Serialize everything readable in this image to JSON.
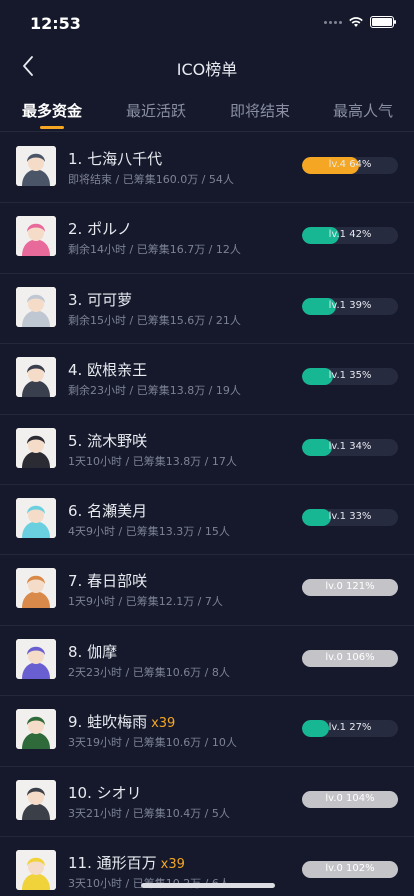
{
  "status": {
    "time": "12:53"
  },
  "nav": {
    "title": "ICO榜单"
  },
  "tabs": [
    {
      "label": "最多资金",
      "active": true
    },
    {
      "label": "最近活跃",
      "active": false
    },
    {
      "label": "即将结束",
      "active": false
    },
    {
      "label": "最高人气",
      "active": false
    }
  ],
  "colors": {
    "teal": "#17b794",
    "orange": "#f5a623",
    "full": "#c4c4c8"
  },
  "items": [
    {
      "title": "1. 七海八千代",
      "badge": "",
      "sub": "即将结束 / 已筹集160.0万 / 54人",
      "level_label": "lv.4 64%",
      "progress": 0.64,
      "color": "#f5a623",
      "full": false,
      "avatar": "#4a5568"
    },
    {
      "title": "2. ポルノ",
      "badge": "",
      "sub": "剩余14小时 / 已筹集16.7万 / 12人",
      "level_label": "lv.1 42%",
      "progress": 0.42,
      "color": "#17b794",
      "full": false,
      "avatar": "#e86a9a"
    },
    {
      "title": "3. 可可萝",
      "badge": "",
      "sub": "剩余15小时 / 已筹集15.6万 / 21人",
      "level_label": "lv.1 39%",
      "progress": 0.39,
      "color": "#17b794",
      "full": false,
      "avatar": "#bfc7d3"
    },
    {
      "title": "4. 欧根亲王",
      "badge": "",
      "sub": "剩余23小时 / 已筹集13.8万 / 19人",
      "level_label": "lv.1 35%",
      "progress": 0.35,
      "color": "#17b794",
      "full": false,
      "avatar": "#3a3f4d"
    },
    {
      "title": "5. 流木野咲",
      "badge": "",
      "sub": "1天10小时 / 已筹集13.8万 / 17人",
      "level_label": "lv.1 34%",
      "progress": 0.34,
      "color": "#17b794",
      "full": false,
      "avatar": "#2b2b33"
    },
    {
      "title": "6. 名瀬美月",
      "badge": "",
      "sub": "4天9小时 / 已筹集13.3万 / 15人",
      "level_label": "lv.1 33%",
      "progress": 0.33,
      "color": "#17b794",
      "full": false,
      "avatar": "#6ad0e0"
    },
    {
      "title": "7. 春日部咲",
      "badge": "",
      "sub": "1天9小时 / 已筹集12.1万 / 7人",
      "level_label": "lv.0 121%",
      "progress": 1.0,
      "color": "#c4c4c8",
      "full": true,
      "avatar": "#d98a4a"
    },
    {
      "title": "8. 伽摩",
      "badge": "",
      "sub": "2天23小时 / 已筹集10.6万 / 8人",
      "level_label": "lv.0 106%",
      "progress": 1.0,
      "color": "#c4c4c8",
      "full": true,
      "avatar": "#6a5fd0"
    },
    {
      "title": "9. 蛙吹梅雨",
      "badge": "x39",
      "sub": "3天19小时 / 已筹集10.6万 / 10人",
      "level_label": "lv.1 27%",
      "progress": 0.27,
      "color": "#17b794",
      "full": false,
      "avatar": "#2f6b3a"
    },
    {
      "title": "10. シオリ",
      "badge": "",
      "sub": "3天21小时 / 已筹集10.4万 / 5人",
      "level_label": "lv.0 104%",
      "progress": 1.0,
      "color": "#c4c4c8",
      "full": true,
      "avatar": "#3b3f48"
    },
    {
      "title": "11. 通形百万",
      "badge": "x39",
      "sub": "3天10小时 / 已筹集10.2万 / 6人",
      "level_label": "lv.0 102%",
      "progress": 1.0,
      "color": "#c4c4c8",
      "full": true,
      "avatar": "#f0d23a"
    }
  ]
}
